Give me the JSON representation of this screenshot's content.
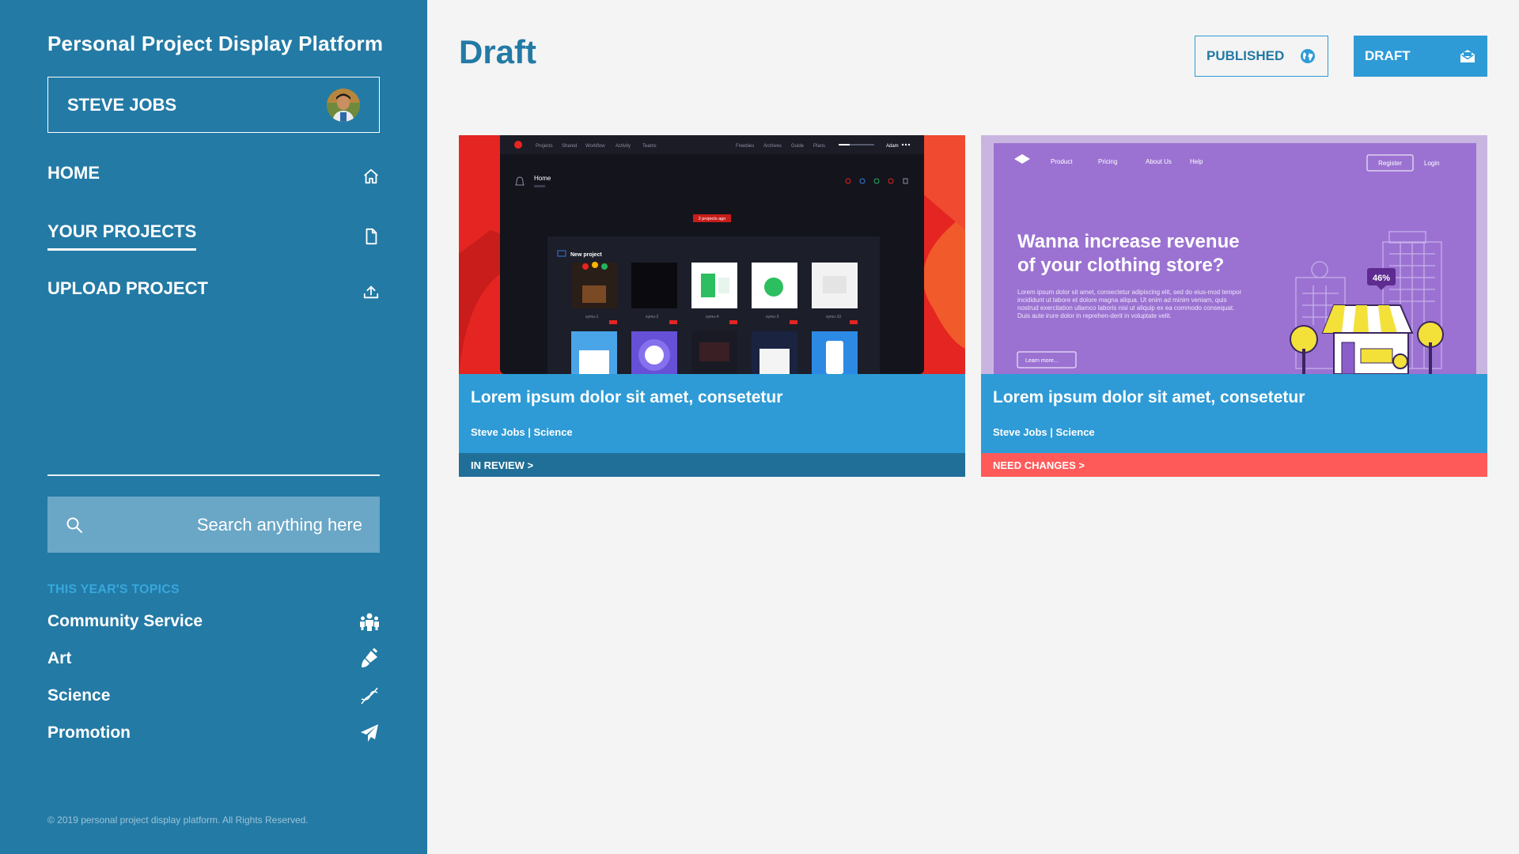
{
  "sidebar": {
    "app_title": "Personal Project Display Platform",
    "user_name": "STEVE JOBS",
    "nav": [
      {
        "label": "HOME",
        "icon": "home-icon"
      },
      {
        "label": "YOUR PROJECTS",
        "icon": "file-icon",
        "active": true
      },
      {
        "label": "UPLOAD PROJECT",
        "icon": "upload-icon"
      }
    ],
    "search": {
      "placeholder": "Search anything here",
      "value": ""
    },
    "topics_heading": "THIS YEAR'S TOPICS",
    "topics": [
      {
        "label": "Community Service",
        "icon": "people-icon"
      },
      {
        "label": "Art",
        "icon": "brush-icon"
      },
      {
        "label": "Science",
        "icon": "dna-icon"
      },
      {
        "label": "Promotion",
        "icon": "paper-plane-icon"
      }
    ],
    "copyright": "© 2019 personal project display platform. All Rights Reserved."
  },
  "main": {
    "page_title": "Draft",
    "tabs": [
      {
        "label": "PUBLISHED",
        "icon": "globe-icon"
      },
      {
        "label": "DRAFT",
        "icon": "envelope-open-icon",
        "active": true
      }
    ],
    "cards": [
      {
        "title": "Lorem ipsum dolor sit amet, consetetur",
        "meta": "Steve Jobs | Science",
        "status": "IN REVIEW >",
        "status_color": "#1f6f98",
        "thumb": {
          "nav": [
            "Projects",
            "Shared",
            "Workflow",
            "Activity",
            "Teams",
            "Freebies",
            "Archives",
            "Guide",
            "Plans",
            "Adam"
          ],
          "breadcrumb": "Home",
          "badge": "2 projects ago",
          "panel_title": "New project"
        }
      },
      {
        "title": "Lorem ipsum dolor sit amet, consetetur",
        "meta": "Steve Jobs | Science",
        "status": "NEED CHANGES >",
        "status_color": "#ff5a5a",
        "thumb": {
          "nav": [
            "Product",
            "Pricing",
            "About Us",
            "Help"
          ],
          "register": "Register",
          "login": "Login",
          "headline_1": "Wanna increase revenue",
          "headline_2": "of your clothing store?",
          "body": "Lorem ipsum dolor sit amet, consectetur adipiscing elit, sed do eius-mod tempor incididunt ut labore et dolore magna aliqua. Ut enim ad minim veniam, quis nostrud exercitation ullamco laboris nisi ut aliquip ex ea commodo consequat. Duis aute irure dolor in reprehen-derit in voluptate velit.",
          "cta": "Learn more...",
          "badge": "46%"
        }
      }
    ]
  },
  "colors": {
    "sidebar": "#237aa5",
    "accent": "#2e9bd6",
    "topics_heading": "#38a7db",
    "need_changes": "#ff5a5a"
  }
}
